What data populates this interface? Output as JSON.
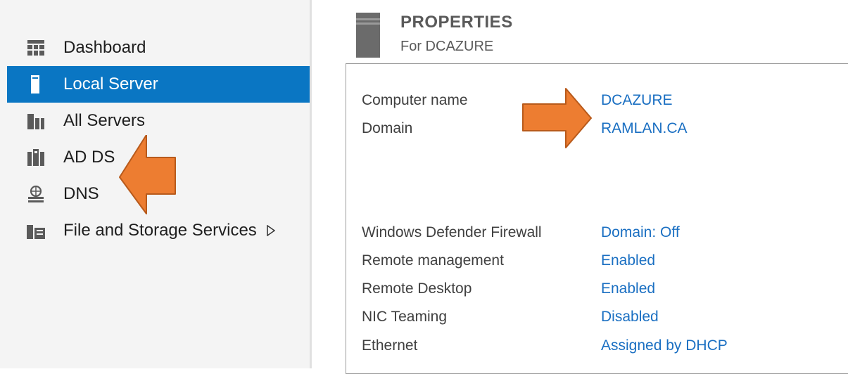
{
  "sidebar": {
    "items": [
      {
        "label": "Dashboard",
        "icon": "dashboard-icon",
        "active": false
      },
      {
        "label": "Local Server",
        "icon": "server-icon",
        "active": true
      },
      {
        "label": "All Servers",
        "icon": "servers-icon",
        "active": false
      },
      {
        "label": "AD DS",
        "icon": "ad-ds-icon",
        "active": false
      },
      {
        "label": "DNS",
        "icon": "dns-icon",
        "active": false
      },
      {
        "label": "File and Storage Services",
        "icon": "file-storage-icon",
        "active": false,
        "expandable": true
      }
    ]
  },
  "properties": {
    "title": "PROPERTIES",
    "subtitle": "For DCAZURE",
    "identity": [
      {
        "label": "Computer name",
        "value": "DCAZURE"
      },
      {
        "label": "Domain",
        "value": "RAMLAN.CA"
      }
    ],
    "settings": [
      {
        "label": "Windows Defender Firewall",
        "value": "Domain: Off"
      },
      {
        "label": "Remote management",
        "value": "Enabled"
      },
      {
        "label": "Remote Desktop",
        "value": "Enabled"
      },
      {
        "label": "NIC Teaming",
        "value": "Disabled"
      },
      {
        "label": "Ethernet",
        "value": "Assigned by DHCP"
      }
    ]
  },
  "colors": {
    "accent": "#0a76c3",
    "link": "#1a6fc2",
    "annotation_arrow": "#ed7d31",
    "annotation_arrow_border": "#b85a1b"
  }
}
